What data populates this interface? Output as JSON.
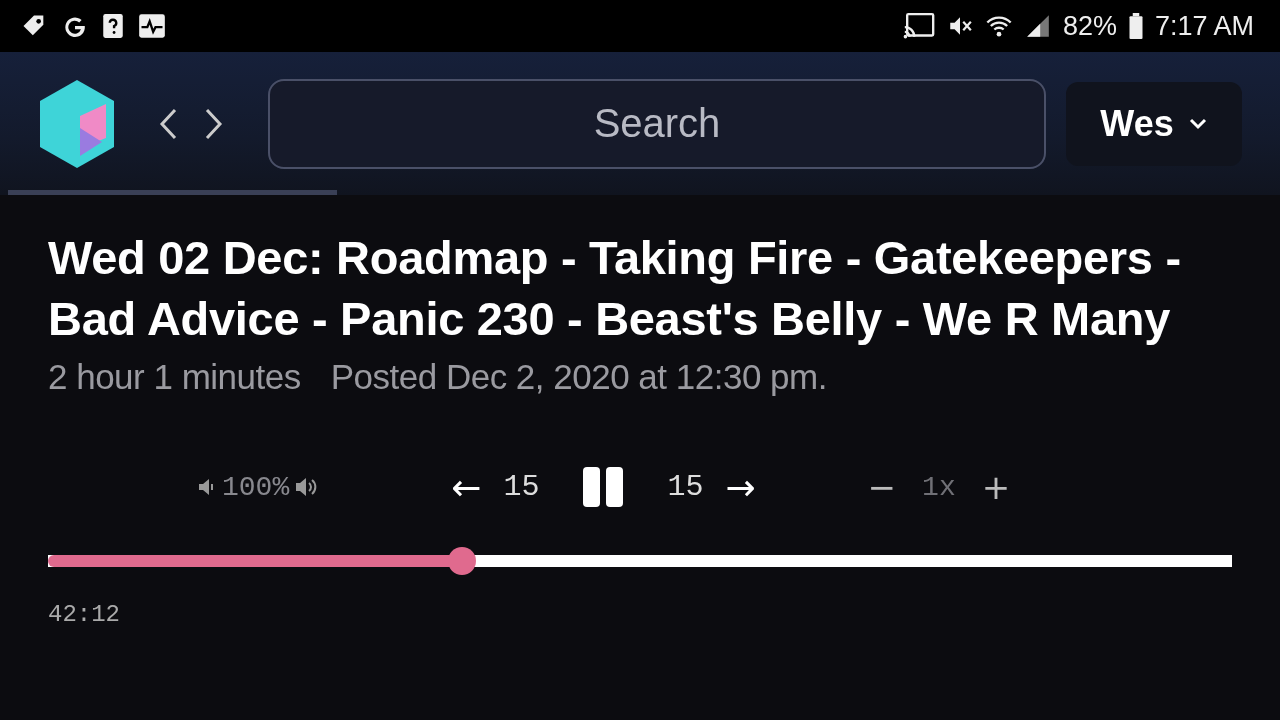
{
  "status_bar": {
    "battery": "82%",
    "time": "7:17 AM"
  },
  "header": {
    "search": {
      "placeholder": "Search"
    },
    "user": "Wes"
  },
  "episode": {
    "title": "Wed 02 Dec: Roadmap - Taking Fire - Gatekeepers - Bad Advice - Panic 230 - Beast's Belly - We R Many",
    "duration": "2 hour 1 minutes",
    "posted": "Posted Dec 2, 2020 at 12:30 pm."
  },
  "controls": {
    "volume": "100%",
    "back_arrow": "←",
    "skip_back": "15",
    "playing": true,
    "skip_forward": "15",
    "forward_arrow": "→",
    "speed_down": "−",
    "speed": "1x",
    "speed_up": "+"
  },
  "progress": {
    "level": 0.35,
    "elapsed": "42:12"
  }
}
